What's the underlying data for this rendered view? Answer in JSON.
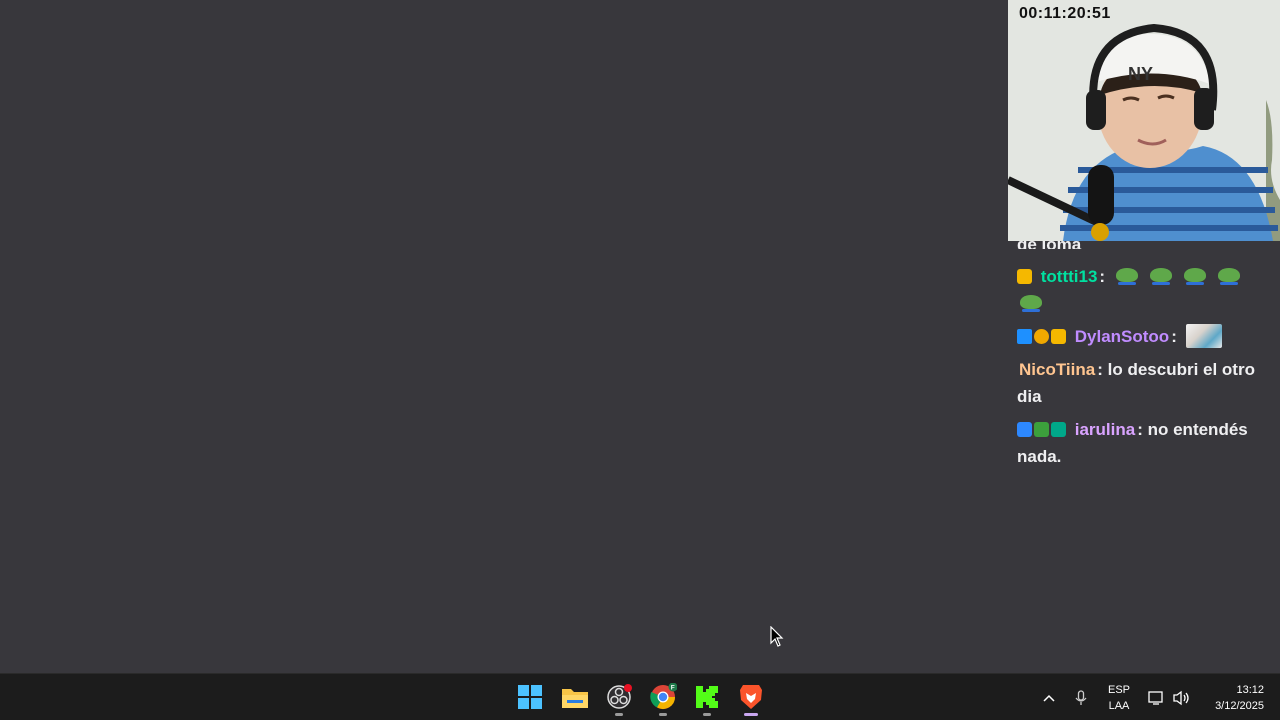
{
  "webcam": {
    "timer": "00:11:20:51"
  },
  "chat": {
    "cutoff_text": "de loma",
    "messages": [
      {
        "user": "tottti13",
        "user_color": "#00e0a0",
        "separator": ":",
        "text": ""
      },
      {
        "user": "DylanSotoo",
        "user_color": "#c08cff",
        "separator": ":",
        "text": ""
      },
      {
        "user": "NicoTiina",
        "user_color": "#ffc590",
        "separator": ":",
        "text": "lo descubri el otro dia"
      },
      {
        "user": "iarulina",
        "user_color": "#d9a3ff",
        "separator": ":",
        "text": "no entendés nada."
      }
    ]
  },
  "taskbar": {
    "apps": [
      {
        "name": "start-button",
        "icon": "windows-logo-icon"
      },
      {
        "name": "file-explorer",
        "icon": "folder-icon"
      },
      {
        "name": "obs-studio",
        "icon": "obs-icon"
      },
      {
        "name": "chrome",
        "icon": "chrome-icon",
        "badge": "F"
      },
      {
        "name": "kick",
        "icon": "kick-icon"
      },
      {
        "name": "brave",
        "icon": "brave-lion-icon"
      }
    ],
    "tray": {
      "language_top": "ESP",
      "language_bottom": "LAA",
      "time": "13:12",
      "date": "3/12/2025"
    }
  }
}
